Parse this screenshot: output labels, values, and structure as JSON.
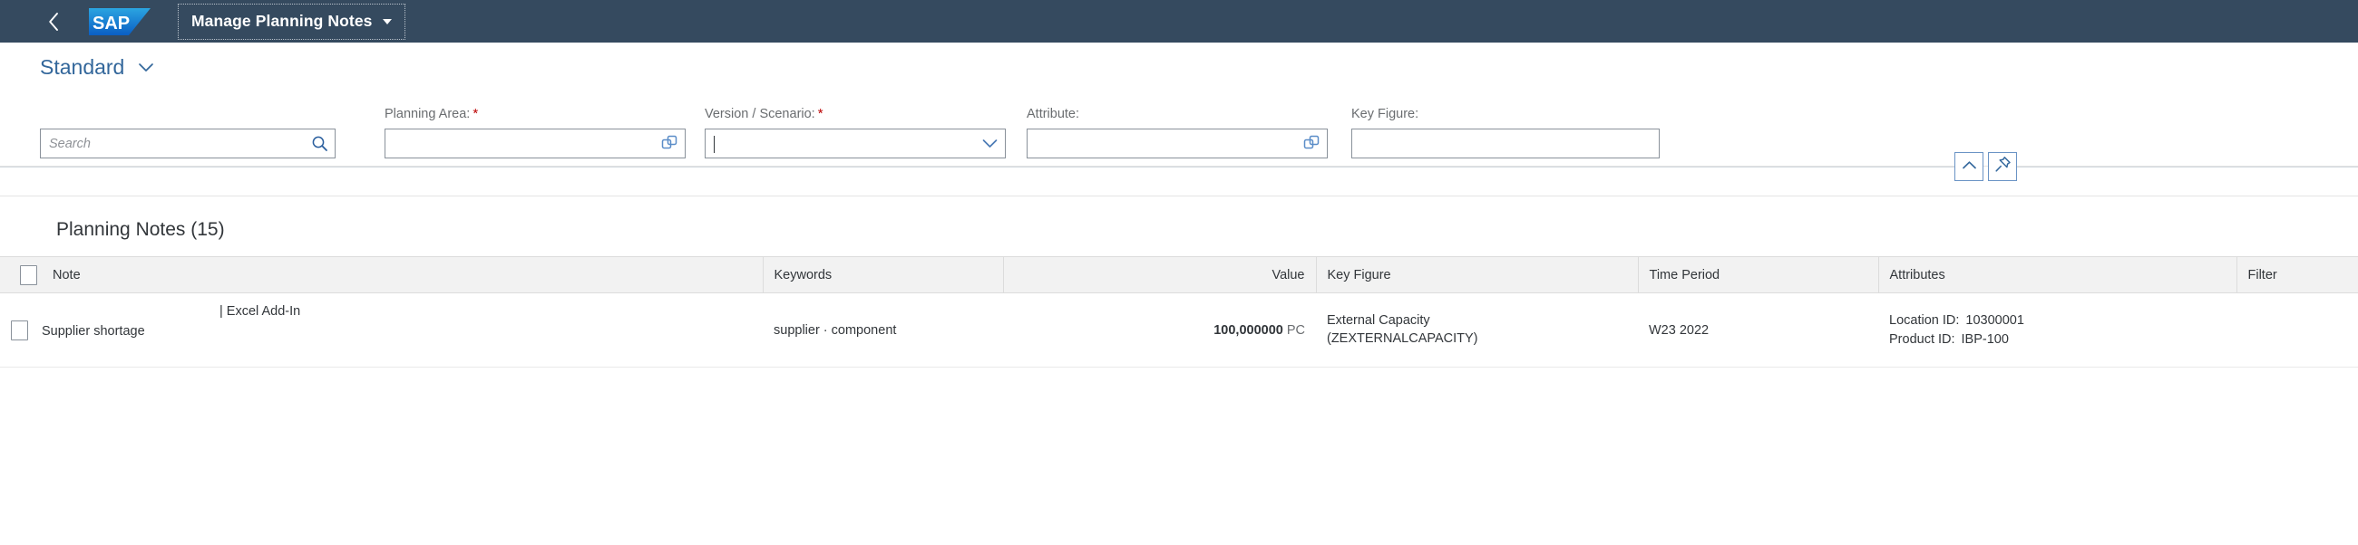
{
  "shell": {
    "back_icon": "chevron-left-icon",
    "logo_text": "SAP",
    "app_title": "Manage Planning Notes",
    "title_caret_icon": "caret-down-icon"
  },
  "variant": {
    "name": "Standard",
    "caret_icon": "chevron-down-icon"
  },
  "filters": {
    "search": {
      "placeholder": "Search",
      "value": "",
      "icon": "search-icon"
    },
    "planning_area": {
      "label": "Planning Area:",
      "required": true,
      "required_marker": "*",
      "value": "",
      "icon": "value-help-icon"
    },
    "version_scenario": {
      "label": "Version / Scenario:",
      "required": true,
      "required_marker": "*",
      "value": "",
      "icon": "chevron-down-icon"
    },
    "attribute": {
      "label": "Attribute:",
      "required": false,
      "value": "",
      "icon": "value-help-icon"
    },
    "key_figure": {
      "label": "Key Figure:",
      "required": false,
      "value": "",
      "icon": ""
    }
  },
  "filter_toggle": {
    "collapse_icon": "chevron-up-icon",
    "pin_icon": "pin-icon"
  },
  "table": {
    "title": "Planning Notes (15)",
    "columns": [
      {
        "label": "",
        "name": "select-all"
      },
      {
        "label": "Note",
        "name": "note"
      },
      {
        "label": "Keywords",
        "name": "keywords"
      },
      {
        "label": "Value",
        "name": "value"
      },
      {
        "label": "Key Figure",
        "name": "key-figure"
      },
      {
        "label": "Time Period",
        "name": "time-period"
      },
      {
        "label": "Attributes",
        "name": "attributes"
      },
      {
        "label": "Filter",
        "name": "filter"
      }
    ],
    "rows": [
      {
        "note_primary": "Supplier shortage",
        "note_secondary": "|  Excel Add-In",
        "keywords": "supplier · component",
        "value_number": "100,000000",
        "value_uom": "PC",
        "key_figure_line1": "External Capacity",
        "key_figure_line2": "(ZEXTERNALCAPACITY)",
        "time_period": "W23 2022",
        "attributes": [
          {
            "key": "Location ID:",
            "value": "10300001"
          },
          {
            "key": "Product ID:",
            "value": "IBP-100"
          }
        ],
        "filter": ""
      }
    ]
  },
  "colors": {
    "shell_bg": "#354a5f",
    "link": "#33679b",
    "required": "#bb0000",
    "logo_blue": "#0a6ed1",
    "header_bg": "#f2f2f2"
  }
}
